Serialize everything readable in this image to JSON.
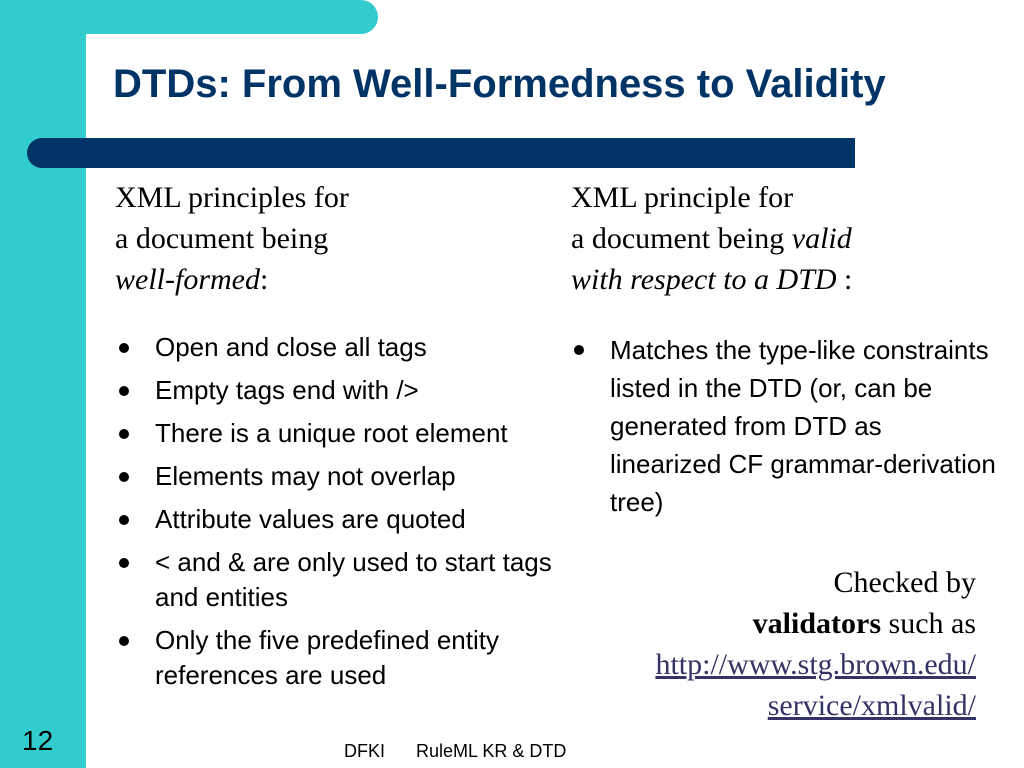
{
  "slide": {
    "title": "DTDs: From Well-Formedness to Validity",
    "number": "12",
    "footer": {
      "left": "DFKI",
      "right": "RuleML KR & DTD"
    }
  },
  "left_column": {
    "heading_line1": "XML principles for",
    "heading_line2": "a document being",
    "heading_emph": "well-formed",
    "heading_tail": ":",
    "bullets": [
      "Open and close all tags",
      "Empty tags end with />",
      "There is a unique root element",
      "Elements may not overlap",
      "Attribute values are quoted",
      "< and & are only used to start tags and entities",
      "Only the five predefined entity references are used"
    ]
  },
  "right_column": {
    "heading_line1": "XML principle for",
    "heading_line2_plain": "a document being ",
    "heading_line2_emph": "valid",
    "heading_line3_emph": "with respect to a DTD",
    "heading_tail": " :",
    "bullets": [
      "Matches the type-like constraints listed in the DTD (or, can be generated from DTD as linearized CF grammar-derivation tree)"
    ],
    "checked_line1": "Checked by",
    "checked_bold": "validators",
    "checked_rest": " such as",
    "link_line1": "http://www.stg.brown.edu/",
    "link_line2": "service/xmlvalid/"
  },
  "colors": {
    "accent_teal": "#33cccc",
    "title_navy": "#003366",
    "link": "#333366"
  }
}
